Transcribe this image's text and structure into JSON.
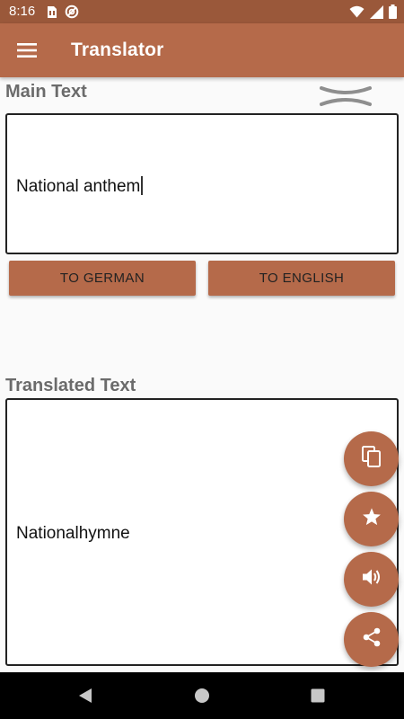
{
  "status_bar": {
    "time": "8:16",
    "icons": [
      "sim-card-icon",
      "at-icon",
      "wifi-icon",
      "signal-icon",
      "battery-icon"
    ]
  },
  "app_bar": {
    "title": "Translator",
    "menu_icon": "hamburger-menu-icon"
  },
  "main": {
    "label": "Main Text",
    "input_text": "National anthem",
    "clear_icon": "clear-icon",
    "buttons": {
      "to_german": "TO GERMAN",
      "to_english": "TO ENGLISH"
    }
  },
  "translated": {
    "label": "Translated Text",
    "output_text": "Nationalhymne"
  },
  "fabs": [
    "copy-icon",
    "star-icon",
    "volume-icon",
    "share-icon"
  ],
  "nav_bar": {
    "icons": [
      "back-icon",
      "home-icon",
      "recents-icon"
    ]
  },
  "colors": {
    "primary": "#b56a4a",
    "primary_dark": "#9a583a",
    "label_gray": "#6b6b6b",
    "background": "#fafafa"
  }
}
